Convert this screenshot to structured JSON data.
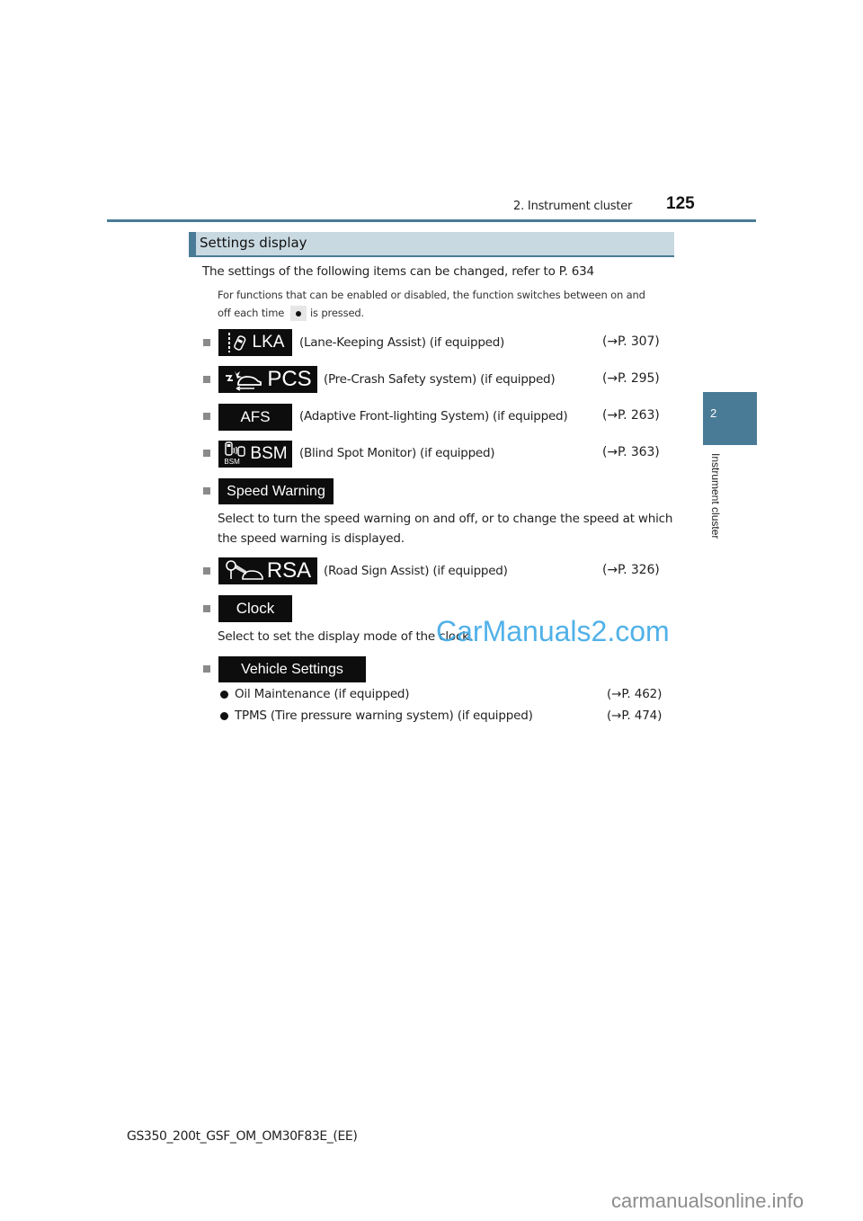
{
  "header": {
    "section": "2. Instrument cluster",
    "page_number": "125"
  },
  "side_tab": {
    "chapter_number": "2",
    "chapter_label": "Instrument cluster"
  },
  "section": {
    "title": "Settings display",
    "intro": "The settings of the following items can be changed, refer to P. 634",
    "note_line1": "For functions that can be enabled or disabled, the function switches between on and",
    "note_line2_before": "off each time",
    "note_line2_after": "is pressed."
  },
  "items": [
    {
      "badge": "LKA",
      "icon": "lane-keeping-icon",
      "description": "(Lane-Keeping Assist) (if equipped)",
      "ref": "(→P. 307)"
    },
    {
      "badge": "PCS",
      "icon": "pre-crash-icon",
      "description": "(Pre-Crash Safety system) (if equipped)",
      "ref": "(→P. 295)"
    },
    {
      "badge": "AFS",
      "icon": "",
      "description": "(Adaptive Front-lighting System) (if equipped)",
      "ref": "(→P. 263)"
    },
    {
      "badge": "BSM",
      "icon": "blind-spot-icon",
      "icon_caption": "BSM",
      "description": "(Blind Spot Monitor) (if equipped)",
      "ref": "(→P. 363)"
    },
    {
      "badge": "Speed Warning",
      "description_line1": "Select to turn the speed warning on and off, or to change the speed at which",
      "description_line2": "the speed warning is displayed."
    },
    {
      "badge": "RSA",
      "icon": "road-sign-icon",
      "description": "(Road Sign Assist) (if equipped)",
      "ref": "(→P. 326)"
    },
    {
      "badge": "Clock",
      "description": "Select to set the display mode of the clock."
    },
    {
      "badge": "Vehicle Settings",
      "subitems": [
        {
          "label": "Oil Maintenance (if equipped)",
          "ref": "(→P. 462)"
        },
        {
          "label": "TPMS (Tire pressure warning system) (if equipped)",
          "ref": "(→P. 474)"
        }
      ]
    }
  ],
  "footer": {
    "doc_code": "GS350_200t_GSF_OM_OM30F83E_(EE)"
  },
  "watermarks": {
    "overlay": "CarManuals2.com",
    "bottom": "carmanualsonline.info"
  },
  "colors": {
    "accent": "#4a7b96",
    "heading_bg": "#c9d9e2",
    "badge_bg": "#0d0d0d",
    "watermark_blue": "#3fa9e6"
  }
}
